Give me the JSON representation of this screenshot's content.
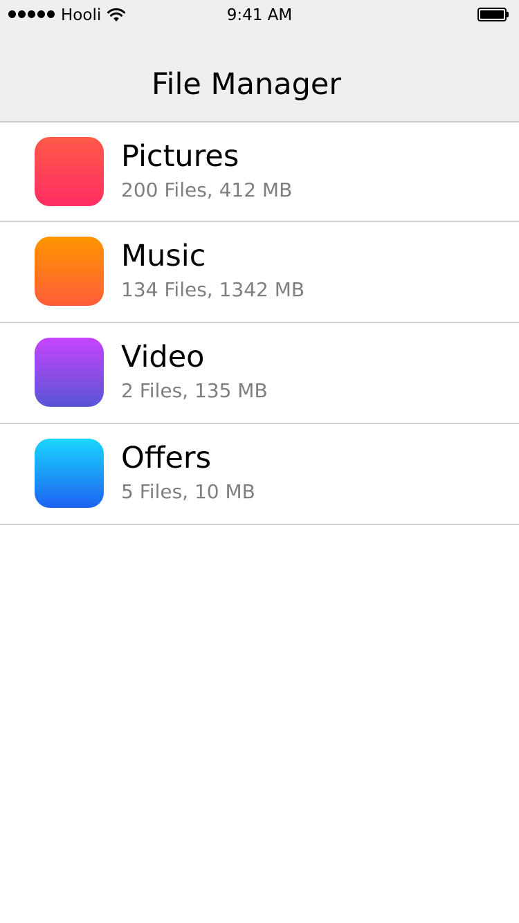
{
  "status_bar": {
    "carrier": "Hooli",
    "time": "9:41 AM",
    "icons": [
      "signal-dots-icon",
      "wifi-icon",
      "battery-icon"
    ]
  },
  "nav": {
    "title": "File Manager"
  },
  "folders": [
    {
      "name": "Pictures",
      "details": "200 Files, 412 MB",
      "icon": "pictures-folder-icon",
      "color_top": "#ff5a48",
      "color_bottom": "#ff2d63"
    },
    {
      "name": "Music",
      "details": "134 Files, 1342 MB",
      "icon": "music-folder-icon",
      "color_top": "#ff9500",
      "color_bottom": "#ff5e3a"
    },
    {
      "name": "Video",
      "details": "2 Files, 135 MB",
      "icon": "video-folder-icon",
      "color_top": "#c644fc",
      "color_bottom": "#5856d6"
    },
    {
      "name": "Offers",
      "details": "5 Files, 10 MB",
      "icon": "offers-folder-icon",
      "color_top": "#1ad6fd",
      "color_bottom": "#1d62f0"
    }
  ]
}
